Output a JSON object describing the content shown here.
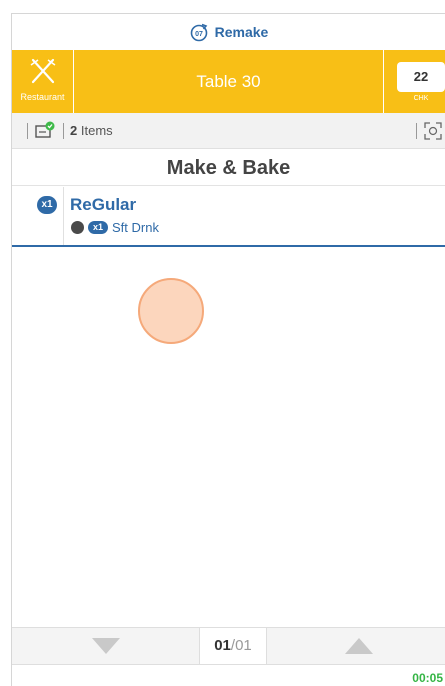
{
  "remake": {
    "label": "Remake",
    "icon": "remake-timer-icon"
  },
  "header": {
    "category_label": "Restaurant",
    "category_icon": "utensils-icon",
    "title": "Table 30",
    "check_number": "22",
    "check_label": "CHK",
    "bg_color": "#f8bf16"
  },
  "infobar": {
    "note_icon": "note-checked-icon",
    "item_count": "2",
    "item_count_suffix": "Items",
    "expand_icon": "expand-icon"
  },
  "station": {
    "name": "Make & Bake"
  },
  "items": [
    {
      "qty": "x1",
      "name": "ReGular",
      "modifiers": [
        {
          "qty": "x1",
          "name": "Sft Drnk"
        }
      ]
    }
  ],
  "pager": {
    "current": "01",
    "separator": "/",
    "total": "01"
  },
  "timer": "00:05",
  "colors": {
    "accent": "#2f6aa7",
    "timer": "#35b545"
  }
}
